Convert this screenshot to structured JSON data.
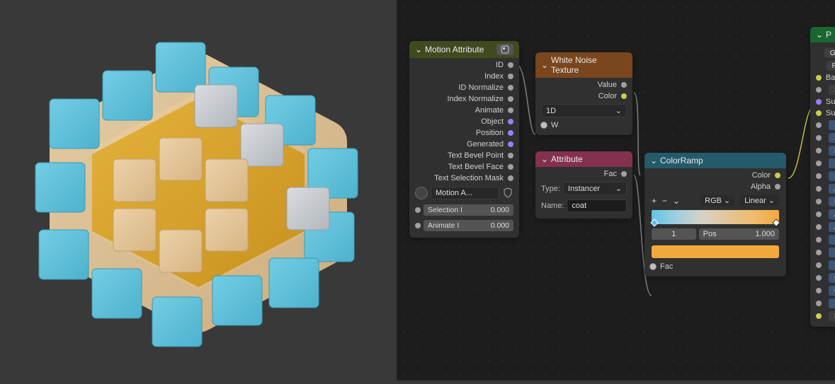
{
  "viewport": {
    "desc": "3d-cube-array-render"
  },
  "nodes": {
    "motion": {
      "title": "Motion Attribute",
      "outs": [
        "ID",
        "Index",
        "ID Normalize",
        "Index Normalize",
        "Animate",
        "Object",
        "Position",
        "Generated",
        "Text Bevel Point",
        "Text Bevel Face",
        "Text Selection Mask"
      ],
      "shader_name": "Motion A...",
      "selection": {
        "label": "Selection I",
        "value": "0.000"
      },
      "animate": {
        "label": "Animate I",
        "value": "0.000"
      }
    },
    "whitenoise": {
      "title": "White Noise Texture",
      "outs": [
        "Value",
        "Color"
      ],
      "dim_value": "1D",
      "in": "W"
    },
    "attribute": {
      "title": "Attribute",
      "outs": [
        "Fac"
      ],
      "type_label": "Type:",
      "type_value": "Instancer",
      "name_label": "Name:",
      "name_value": "coat"
    },
    "colorramp": {
      "title": "ColorRamp",
      "outs": [
        "Color",
        "Alpha"
      ],
      "plus": "+",
      "minus": "−",
      "flip": "⌄",
      "mode": "RGB",
      "interp": "Linear",
      "stop_index": "1",
      "pos_label": "Pos",
      "pos_value": "1.000",
      "in": "Fac"
    },
    "principled": {
      "title": "P",
      "pill_top": [
        "GG",
        "Ra"
      ],
      "ins": [
        "Base",
        "S",
        "Sul",
        "Subs",
        "S",
        "S",
        "M",
        "S",
        "S",
        "A",
        "R",
        "A",
        "A",
        "S",
        "S",
        "Sl",
        "C",
        "C",
        "IC",
        "E"
      ]
    }
  }
}
